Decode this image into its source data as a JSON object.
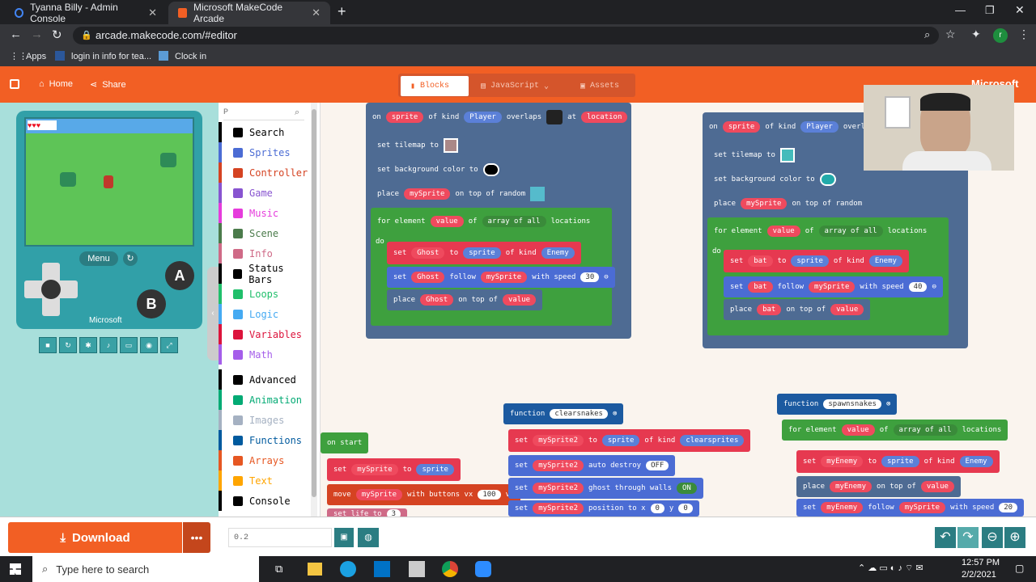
{
  "browser": {
    "tabs": [
      {
        "title": "Tyanna Billy - Admin Console"
      },
      {
        "title": "Microsoft MakeCode Arcade"
      }
    ],
    "url": "arcade.makecode.com/#editor",
    "bookmarks": [
      "Apps",
      "login in info for tea...",
      "Clock in"
    ],
    "profile_initial": "r"
  },
  "header": {
    "home": "Home",
    "share": "Share",
    "brand": "Microsoft",
    "tabs": [
      {
        "label": "Blocks"
      },
      {
        "label": "JavaScript"
      },
      {
        "label": "Assets"
      }
    ]
  },
  "simulator": {
    "menu": "Menu",
    "btn_a": "A",
    "btn_b": "B",
    "brand": "Microsoft"
  },
  "toolbox": {
    "search_placeholder": "P",
    "categories": [
      {
        "label": "Search",
        "color": "#000000"
      },
      {
        "label": "Sprites",
        "color": "#4b6cd4"
      },
      {
        "label": "Controller",
        "color": "#d54322"
      },
      {
        "label": "Game",
        "color": "#8854d0"
      },
      {
        "label": "Music",
        "color": "#e63cdc"
      },
      {
        "label": "Scene",
        "color": "#4b7b4b"
      },
      {
        "label": "Info",
        "color": "#cf6a87"
      },
      {
        "label": "Status Bars",
        "color": "#000000"
      },
      {
        "label": "Loops",
        "color": "#20bf6b"
      },
      {
        "label": "Logic",
        "color": "#45aaf2"
      },
      {
        "label": "Variables",
        "color": "#dc143c"
      },
      {
        "label": "Math",
        "color": "#a55eea"
      },
      {
        "label": "Advanced",
        "color": "#000000"
      },
      {
        "label": "Animation",
        "color": "#03aa74"
      },
      {
        "label": "Images",
        "color": "#a5b1c2"
      },
      {
        "label": "Functions",
        "color": "#005a9e"
      },
      {
        "label": "Arrays",
        "color": "#e65722"
      },
      {
        "label": "Text",
        "color": "#ffa500"
      },
      {
        "label": "Console",
        "color": "#000000"
      }
    ]
  },
  "blocks": {
    "b1": {
      "on": "on",
      "sprite": "sprite",
      "of_kind": "of kind",
      "player": "Player",
      "overlaps": "overlaps",
      "at": "at",
      "location": "location",
      "set_tilemap": "set tilemap to",
      "set_bg": "set background color to",
      "place": "place",
      "mysprite": "mySprite",
      "on_top_random": "on top of random",
      "for_element": "for element",
      "value": "value",
      "of": "of",
      "array_all": "array of all",
      "locations": "locations",
      "do": "do",
      "set": "set",
      "ghost": "Ghost",
      "to": "to",
      "enemy": "Enemy",
      "follow": "follow",
      "with_speed": "with speed",
      "speed": "30",
      "on_top_of": "on top of"
    },
    "b2": {
      "overlap_short": "overlap",
      "bat": "bat",
      "speed": "40"
    },
    "fn1": {
      "function": "function",
      "name": "clearsnakes",
      "mysprite2": "mySprite2",
      "clearsprites": "clearsprites",
      "auto_destroy": "auto destroy",
      "off": "OFF",
      "ghost_walls": "ghost through walls",
      "on": "ON",
      "position_x": "position to x",
      "y": "y",
      "zero": "0"
    },
    "fn2": {
      "name": "spawnsnakes",
      "myenemy": "myEnemy",
      "speed": "20"
    },
    "start": {
      "on_start": "on start",
      "move": "move",
      "buttons_vx": "with buttons vx",
      "vx": "100",
      "vy": "vy",
      "set_life": "set life to",
      "life": "3"
    }
  },
  "bottom": {
    "download": "Download",
    "project_name": "0.2"
  },
  "taskbar": {
    "search_placeholder": "Type here to search",
    "time": "12:57 PM",
    "date": "2/2/2021"
  }
}
